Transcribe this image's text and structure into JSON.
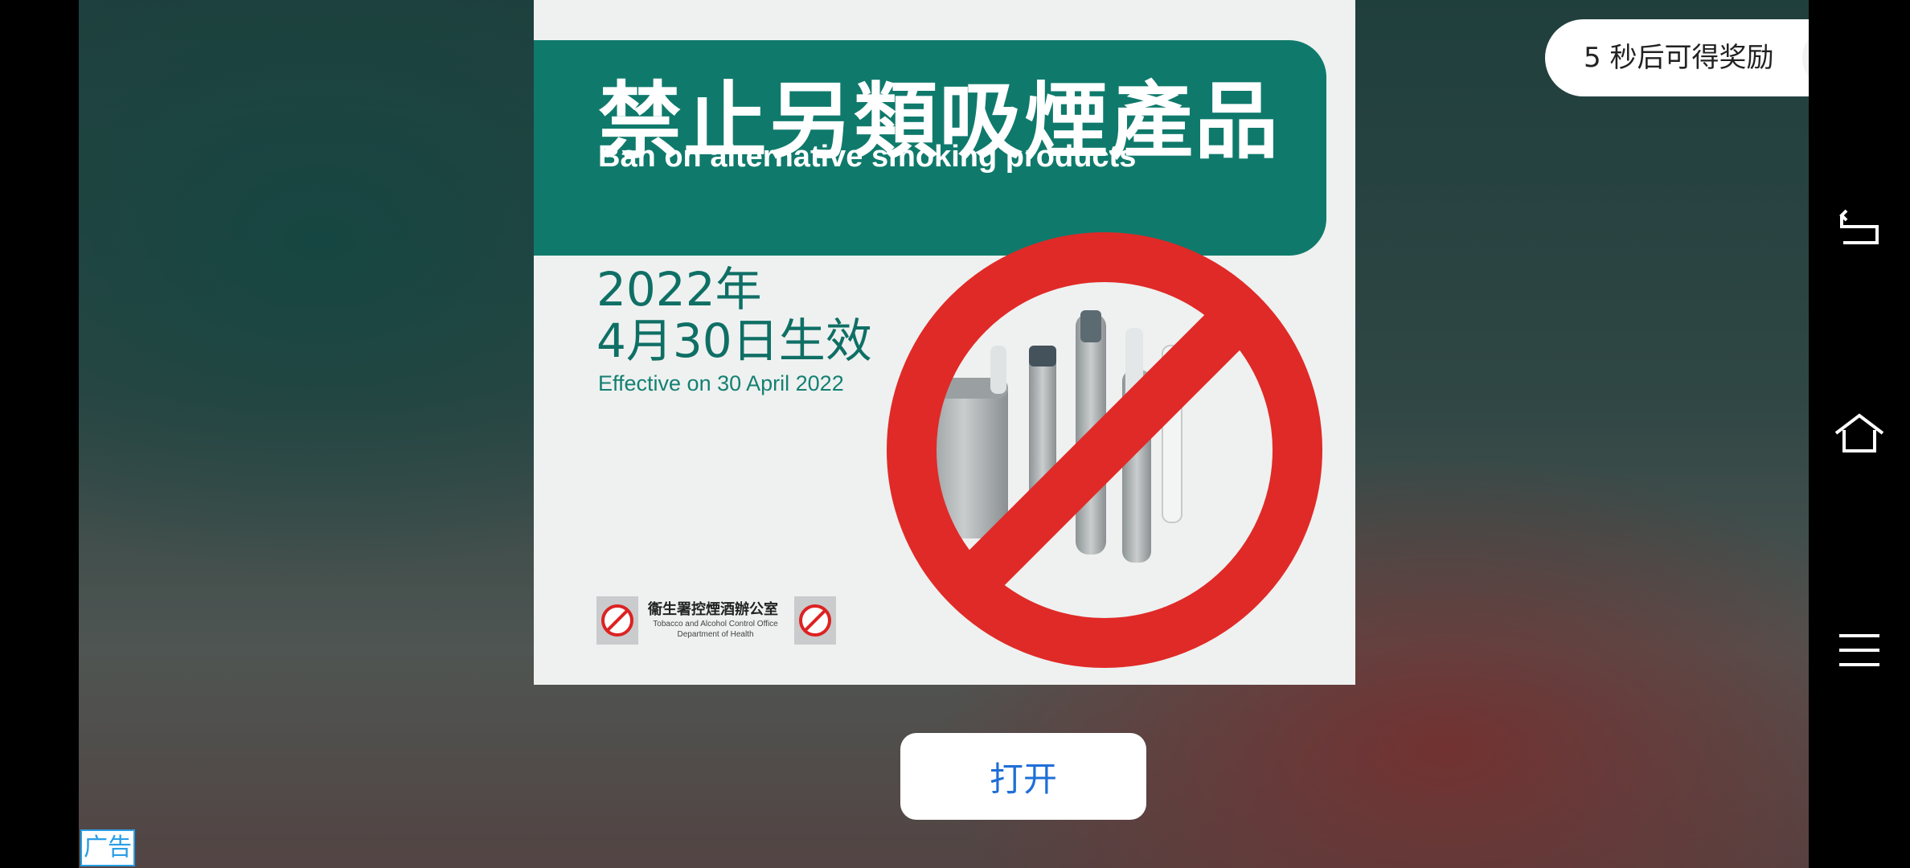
{
  "ad": {
    "title_zh": "禁止另類吸煙產品",
    "title_en": "Ban on alternative smoking products",
    "date_zh": "2022年\n4月30日生效",
    "date_en": "Effective on 30 April 2022",
    "footer_org_zh": "衞生署控煙酒辦公室",
    "footer_org_en": "Tobacco and Alcohol Control Office\nDepartment of Health",
    "colors": {
      "banner": "#0f7a6c",
      "ban_sign": "#e02a27"
    }
  },
  "reward": {
    "countdown_text": "5 秒后可得奖励",
    "close_icon": "close-icon"
  },
  "open_button": {
    "label": "打开"
  },
  "ad_label": "广告",
  "nav_bar": {
    "buttons": [
      "back-icon",
      "home-icon",
      "menu-icon"
    ]
  }
}
